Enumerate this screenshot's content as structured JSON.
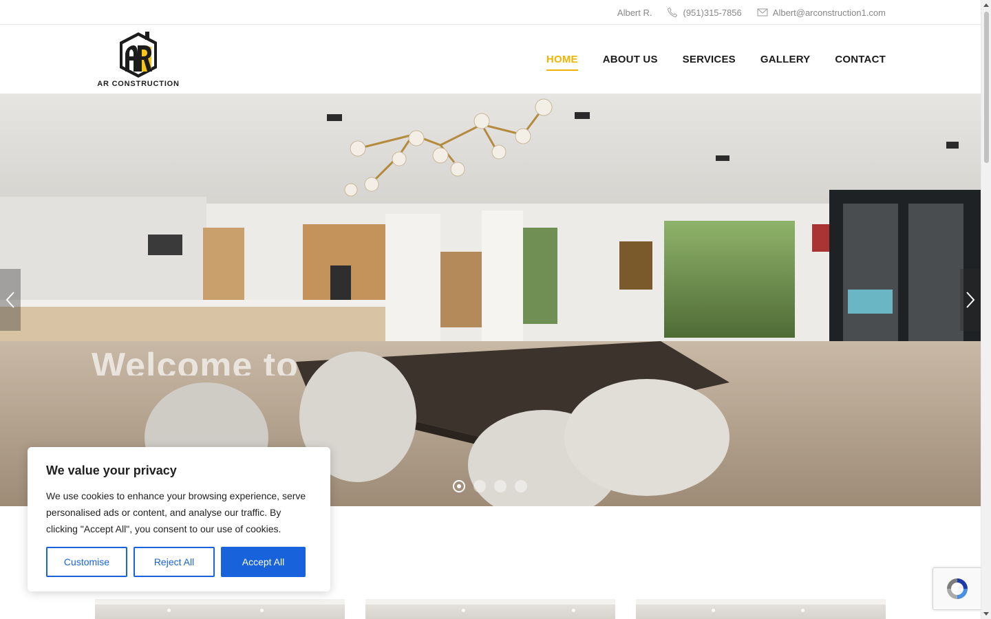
{
  "topbar": {
    "name": "Albert R.",
    "phone": "(951)315-7856",
    "email": "Albert@arconstruction1.com"
  },
  "logo": {
    "monogram": "AR",
    "text": "AR CONSTRUCTION"
  },
  "nav": {
    "items": [
      {
        "label": "HOME",
        "active": true
      },
      {
        "label": "ABOUT US",
        "active": false
      },
      {
        "label": "SERVICES",
        "active": false
      },
      {
        "label": "GALLERY",
        "active": false
      },
      {
        "label": "CONTACT",
        "active": false
      }
    ],
    "accent_color": "#f0b400"
  },
  "hero": {
    "title": "Welcome to",
    "slides_count": 4,
    "active_slide": 1
  },
  "cookie": {
    "title": "We value your privacy",
    "text": "We use cookies to enhance your browsing experience, serve personalised ads or content, and analyse our traffic. By clicking \"Accept All\", you consent to our use of cookies.",
    "customise_label": "Customise",
    "reject_label": "Reject All",
    "accept_label": "Accept All",
    "button_color": "#1863dc"
  },
  "icons": {
    "phone": "phone-icon",
    "email": "envelope-icon",
    "prev": "chevron-left-icon",
    "next": "chevron-right-icon",
    "captcha": "recaptcha-icon"
  }
}
